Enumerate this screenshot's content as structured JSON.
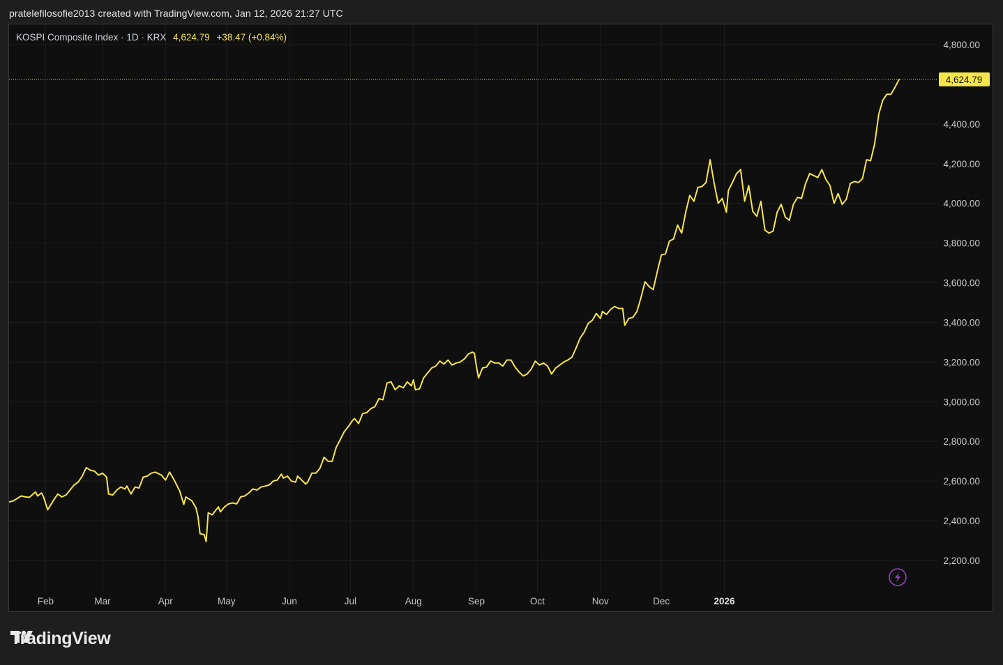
{
  "header": {
    "caption": "pratelefilosofie2013 created with TradingView.com, Jan 12, 2026 21:27 UTC"
  },
  "legend": {
    "symbol": "KOSPI Composite Index · 1D · KRX",
    "last": "4,624.79",
    "change": "+38.47 (+0.84%)"
  },
  "footer": {
    "brand": "TradingView"
  },
  "colors": {
    "line": "#f7e64b",
    "background": "#0f0f0f",
    "grid": "#1d1d1d",
    "price_label_bg": "#f7e64b",
    "lightning": "#9b3fc7"
  },
  "icons": {
    "lightning": "lightning-icon",
    "logo": "tradingview-logo-icon"
  },
  "chart_data": {
    "type": "line",
    "title": "KOSPI Composite Index",
    "xlabel": "",
    "ylabel": "",
    "ylim": [
      2000,
      4900
    ],
    "yticks": [
      2200,
      2400,
      2600,
      2800,
      3000,
      3200,
      3400,
      3600,
      3800,
      4000,
      4200,
      4400,
      4800
    ],
    "ytick_labels": [
      "2,200.00",
      "2,400.00",
      "2,600.00",
      "2,800.00",
      "3,000.00",
      "3,200.00",
      "3,400.00",
      "3,600.00",
      "3,800.00",
      "4,000.00",
      "4,200.00",
      "4,400.00",
      "4,800.00"
    ],
    "xticks": [
      {
        "date": "2025-02-01",
        "label": "Feb"
      },
      {
        "date": "2025-03-01",
        "label": "Mar"
      },
      {
        "date": "2025-04-01",
        "label": "Apr"
      },
      {
        "date": "2025-05-01",
        "label": "May"
      },
      {
        "date": "2025-06-01",
        "label": "Jun"
      },
      {
        "date": "2025-07-01",
        "label": "Jul"
      },
      {
        "date": "2025-08-01",
        "label": "Aug"
      },
      {
        "date": "2025-09-01",
        "label": "Sep"
      },
      {
        "date": "2025-10-01",
        "label": "Oct"
      },
      {
        "date": "2025-11-01",
        "label": "Nov"
      },
      {
        "date": "2025-12-01",
        "label": "Dec"
      },
      {
        "date": "2026-01-01",
        "label": "2026",
        "bold": true
      }
    ],
    "last_price": 4624.79,
    "last_price_label": "4,624.79",
    "grid": true,
    "series": [
      {
        "values": [
          [
            "2025-01-14",
            2495
          ],
          [
            "2025-01-16",
            2500
          ],
          [
            "2025-01-20",
            2525
          ],
          [
            "2025-01-22",
            2520
          ],
          [
            "2025-01-24",
            2518
          ],
          [
            "2025-01-27",
            2545
          ],
          [
            "2025-01-28",
            2525
          ],
          [
            "2025-01-30",
            2540
          ],
          [
            "2025-01-31",
            2520
          ],
          [
            "2025-02-02",
            2455
          ],
          [
            "2025-02-05",
            2505
          ],
          [
            "2025-02-07",
            2535
          ],
          [
            "2025-02-09",
            2520
          ],
          [
            "2025-02-11",
            2530
          ],
          [
            "2025-02-13",
            2555
          ],
          [
            "2025-02-15",
            2580
          ],
          [
            "2025-02-17",
            2595
          ],
          [
            "2025-02-19",
            2625
          ],
          [
            "2025-02-21",
            2668
          ],
          [
            "2025-02-23",
            2655
          ],
          [
            "2025-02-25",
            2650
          ],
          [
            "2025-02-27",
            2630
          ],
          [
            "2025-03-01",
            2640
          ],
          [
            "2025-03-03",
            2620
          ],
          [
            "2025-03-04",
            2535
          ],
          [
            "2025-03-06",
            2530
          ],
          [
            "2025-03-08",
            2555
          ],
          [
            "2025-03-10",
            2570
          ],
          [
            "2025-03-12",
            2560
          ],
          [
            "2025-03-13",
            2575
          ],
          [
            "2025-03-15",
            2535
          ],
          [
            "2025-03-17",
            2570
          ],
          [
            "2025-03-19",
            2565
          ],
          [
            "2025-03-21",
            2620
          ],
          [
            "2025-03-23",
            2625
          ],
          [
            "2025-03-25",
            2640
          ],
          [
            "2025-03-27",
            2645
          ],
          [
            "2025-03-30",
            2630
          ],
          [
            "2025-04-01",
            2605
          ],
          [
            "2025-04-03",
            2645
          ],
          [
            "2025-04-05",
            2610
          ],
          [
            "2025-04-08",
            2550
          ],
          [
            "2025-04-10",
            2482
          ],
          [
            "2025-04-11",
            2520
          ],
          [
            "2025-04-14",
            2500
          ],
          [
            "2025-04-16",
            2465
          ],
          [
            "2025-04-17",
            2420
          ],
          [
            "2025-04-18",
            2335
          ],
          [
            "2025-04-20",
            2330
          ],
          [
            "2025-04-21",
            2295
          ],
          [
            "2025-04-22",
            2440
          ],
          [
            "2025-04-24",
            2430
          ],
          [
            "2025-04-27",
            2470
          ],
          [
            "2025-04-28",
            2445
          ],
          [
            "2025-04-30",
            2470
          ],
          [
            "2025-05-02",
            2485
          ],
          [
            "2025-05-04",
            2490
          ],
          [
            "2025-05-06",
            2485
          ],
          [
            "2025-05-08",
            2520
          ],
          [
            "2025-05-10",
            2525
          ],
          [
            "2025-05-12",
            2540
          ],
          [
            "2025-05-14",
            2560
          ],
          [
            "2025-05-16",
            2555
          ],
          [
            "2025-05-18",
            2570
          ],
          [
            "2025-05-20",
            2575
          ],
          [
            "2025-05-22",
            2580
          ],
          [
            "2025-05-24",
            2600
          ],
          [
            "2025-05-26",
            2605
          ],
          [
            "2025-05-28",
            2635
          ],
          [
            "2025-05-29",
            2615
          ],
          [
            "2025-05-31",
            2625
          ],
          [
            "2025-06-02",
            2600
          ],
          [
            "2025-06-04",
            2595
          ],
          [
            "2025-06-05",
            2625
          ],
          [
            "2025-06-07",
            2605
          ],
          [
            "2025-06-09",
            2585
          ],
          [
            "2025-06-10",
            2595
          ],
          [
            "2025-06-12",
            2640
          ],
          [
            "2025-06-14",
            2640
          ],
          [
            "2025-06-16",
            2665
          ],
          [
            "2025-06-18",
            2720
          ],
          [
            "2025-06-20",
            2700
          ],
          [
            "2025-06-22",
            2700
          ],
          [
            "2025-06-24",
            2770
          ],
          [
            "2025-06-26",
            2810
          ],
          [
            "2025-06-28",
            2850
          ],
          [
            "2025-06-30",
            2875
          ],
          [
            "2025-07-02",
            2905
          ],
          [
            "2025-07-03",
            2915
          ],
          [
            "2025-07-05",
            2890
          ],
          [
            "2025-07-07",
            2940
          ],
          [
            "2025-07-09",
            2945
          ],
          [
            "2025-07-11",
            2965
          ],
          [
            "2025-07-13",
            2975
          ],
          [
            "2025-07-15",
            3015
          ],
          [
            "2025-07-17",
            3010
          ],
          [
            "2025-07-19",
            3095
          ],
          [
            "2025-07-21",
            3100
          ],
          [
            "2025-07-23",
            3060
          ],
          [
            "2025-07-25",
            3080
          ],
          [
            "2025-07-27",
            3070
          ],
          [
            "2025-07-29",
            3100
          ],
          [
            "2025-07-31",
            3080
          ],
          [
            "2025-08-01",
            3110
          ],
          [
            "2025-08-02",
            3060
          ],
          [
            "2025-08-04",
            3065
          ],
          [
            "2025-08-06",
            3120
          ],
          [
            "2025-08-08",
            3145
          ],
          [
            "2025-08-10",
            3170
          ],
          [
            "2025-08-12",
            3180
          ],
          [
            "2025-08-14",
            3205
          ],
          [
            "2025-08-16",
            3190
          ],
          [
            "2025-08-18",
            3210
          ],
          [
            "2025-08-20",
            3185
          ],
          [
            "2025-08-22",
            3195
          ],
          [
            "2025-08-24",
            3200
          ],
          [
            "2025-08-26",
            3215
          ],
          [
            "2025-08-28",
            3240
          ],
          [
            "2025-08-30",
            3250
          ],
          [
            "2025-08-31",
            3245
          ],
          [
            "2025-09-01",
            3180
          ],
          [
            "2025-09-02",
            3120
          ],
          [
            "2025-09-04",
            3170
          ],
          [
            "2025-09-06",
            3175
          ],
          [
            "2025-09-08",
            3205
          ],
          [
            "2025-09-10",
            3195
          ],
          [
            "2025-09-12",
            3195
          ],
          [
            "2025-09-14",
            3180
          ],
          [
            "2025-09-16",
            3210
          ],
          [
            "2025-09-18",
            3210
          ],
          [
            "2025-09-20",
            3175
          ],
          [
            "2025-09-22",
            3150
          ],
          [
            "2025-09-24",
            3130
          ],
          [
            "2025-09-26",
            3140
          ],
          [
            "2025-09-28",
            3165
          ],
          [
            "2025-09-30",
            3205
          ],
          [
            "2025-10-02",
            3185
          ],
          [
            "2025-10-04",
            3195
          ],
          [
            "2025-10-06",
            3180
          ],
          [
            "2025-10-08",
            3140
          ],
          [
            "2025-10-10",
            3170
          ],
          [
            "2025-10-12",
            3185
          ],
          [
            "2025-10-14",
            3200
          ],
          [
            "2025-10-16",
            3210
          ],
          [
            "2025-10-18",
            3225
          ],
          [
            "2025-10-20",
            3270
          ],
          [
            "2025-10-22",
            3320
          ],
          [
            "2025-10-24",
            3350
          ],
          [
            "2025-10-26",
            3395
          ],
          [
            "2025-10-28",
            3410
          ],
          [
            "2025-10-30",
            3445
          ],
          [
            "2025-11-01",
            3420
          ],
          [
            "2025-11-02",
            3455
          ],
          [
            "2025-11-04",
            3440
          ],
          [
            "2025-11-06",
            3465
          ],
          [
            "2025-11-08",
            3480
          ],
          [
            "2025-11-10",
            3470
          ],
          [
            "2025-11-12",
            3470
          ],
          [
            "2025-11-13",
            3385
          ],
          [
            "2025-11-15",
            3420
          ],
          [
            "2025-11-17",
            3425
          ],
          [
            "2025-11-19",
            3455
          ],
          [
            "2025-11-21",
            3525
          ],
          [
            "2025-11-23",
            3605
          ],
          [
            "2025-11-25",
            3580
          ],
          [
            "2025-11-27",
            3565
          ],
          [
            "2025-11-29",
            3655
          ],
          [
            "2025-12-01",
            3740
          ],
          [
            "2025-12-03",
            3745
          ],
          [
            "2025-12-05",
            3810
          ],
          [
            "2025-12-07",
            3820
          ],
          [
            "2025-12-09",
            3890
          ],
          [
            "2025-12-11",
            3850
          ],
          [
            "2025-12-13",
            3955
          ],
          [
            "2025-12-15",
            4040
          ],
          [
            "2025-12-17",
            4010
          ],
          [
            "2025-12-19",
            4080
          ],
          [
            "2025-12-21",
            4085
          ],
          [
            "2025-12-23",
            4105
          ],
          [
            "2025-12-25",
            4220
          ],
          [
            "2025-12-27",
            4100
          ],
          [
            "2025-12-29",
            4000
          ],
          [
            "2025-12-31",
            4025
          ],
          [
            "2026-01-02",
            3955
          ],
          [
            "2026-01-03",
            4065
          ],
          [
            "2026-01-05",
            4105
          ],
          [
            "2026-01-07",
            4150
          ],
          [
            "2026-01-09",
            4170
          ],
          [
            "2026-01-11",
            4010
          ],
          [
            "2026-01-13",
            4090
          ],
          [
            "2026-01-15",
            3960
          ],
          [
            "2026-01-17",
            3935
          ],
          [
            "2026-01-19",
            4010
          ],
          [
            "2026-01-21",
            3865
          ],
          [
            "2026-01-23",
            3850
          ],
          [
            "2026-01-25",
            3860
          ],
          [
            "2026-01-27",
            3955
          ],
          [
            "2026-01-29",
            3995
          ],
          [
            "2026-01-31",
            3930
          ],
          [
            "2026-02-02",
            3915
          ],
          [
            "2026-02-04",
            3995
          ],
          [
            "2026-02-06",
            4030
          ],
          [
            "2026-02-08",
            4025
          ],
          [
            "2026-02-10",
            4100
          ],
          [
            "2026-02-12",
            4150
          ],
          [
            "2026-02-14",
            4140
          ],
          [
            "2026-02-16",
            4130
          ],
          [
            "2026-02-18",
            4170
          ],
          [
            "2026-02-20",
            4120
          ],
          [
            "2026-02-22",
            4090
          ],
          [
            "2026-02-24",
            4000
          ],
          [
            "2026-02-26",
            4050
          ],
          [
            "2026-02-28",
            3995
          ],
          [
            "2026-03-02",
            4020
          ],
          [
            "2026-03-04",
            4100
          ],
          [
            "2026-03-06",
            4110
          ],
          [
            "2026-03-08",
            4105
          ],
          [
            "2026-03-10",
            4125
          ],
          [
            "2026-03-12",
            4220
          ],
          [
            "2026-03-14",
            4215
          ],
          [
            "2026-03-16",
            4300
          ],
          [
            "2026-03-18",
            4450
          ],
          [
            "2026-03-20",
            4520
          ],
          [
            "2026-03-22",
            4550
          ],
          [
            "2026-03-24",
            4550
          ],
          [
            "2026-03-26",
            4585
          ],
          [
            "2026-03-28",
            4624.79
          ]
        ]
      }
    ]
  }
}
